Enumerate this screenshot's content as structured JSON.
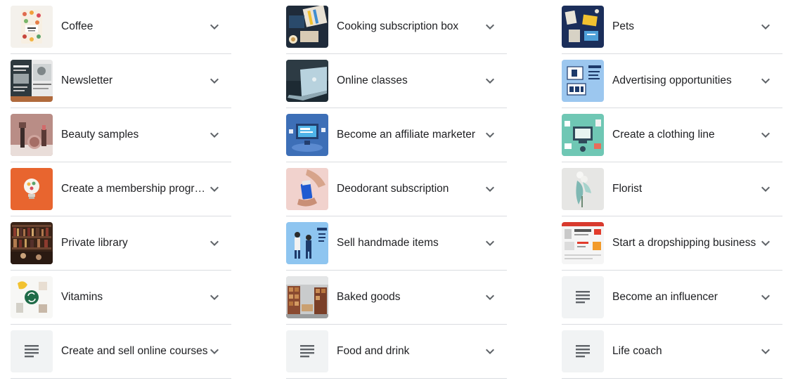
{
  "columns": [
    {
      "items": [
        {
          "label": "Coffee",
          "icon": "coffee-bag-image"
        },
        {
          "label": "Newsletter",
          "icon": "newsletter-image"
        },
        {
          "label": "Beauty samples",
          "icon": "beauty-products-image"
        },
        {
          "label": "Create a membership program",
          "icon": "lightbulb-image"
        },
        {
          "label": "Private library",
          "icon": "library-image"
        },
        {
          "label": "Vitamins",
          "icon": "vitamins-image"
        },
        {
          "label": "Create and sell online courses",
          "icon": "document-icon"
        }
      ]
    },
    {
      "items": [
        {
          "label": "Cooking subscription box",
          "icon": "cooking-box-image"
        },
        {
          "label": "Online classes",
          "icon": "laptop-image"
        },
        {
          "label": "Become an affiliate marketer",
          "icon": "affiliate-image"
        },
        {
          "label": "Deodorant subscription",
          "icon": "deodorant-image"
        },
        {
          "label": "Sell handmade items",
          "icon": "handmade-sale-image"
        },
        {
          "label": "Baked goods",
          "icon": "warehouse-image"
        },
        {
          "label": "Food and drink",
          "icon": "document-icon"
        }
      ]
    },
    {
      "items": [
        {
          "label": "Pets",
          "icon": "pet-products-image"
        },
        {
          "label": "Advertising opportunities",
          "icon": "marketing-image"
        },
        {
          "label": "Create a clothing line",
          "icon": "clothing-design-image"
        },
        {
          "label": "Florist",
          "icon": "flowers-image"
        },
        {
          "label": "Start a dropshipping business",
          "icon": "webshop-image"
        },
        {
          "label": "Become an influencer",
          "icon": "document-icon"
        },
        {
          "label": "Life coach",
          "icon": "document-icon"
        }
      ]
    }
  ],
  "colors": {
    "text": "#202124",
    "chevron": "#5f6368",
    "divider": "#dadce0",
    "placeholder_bg": "#f1f3f4"
  }
}
